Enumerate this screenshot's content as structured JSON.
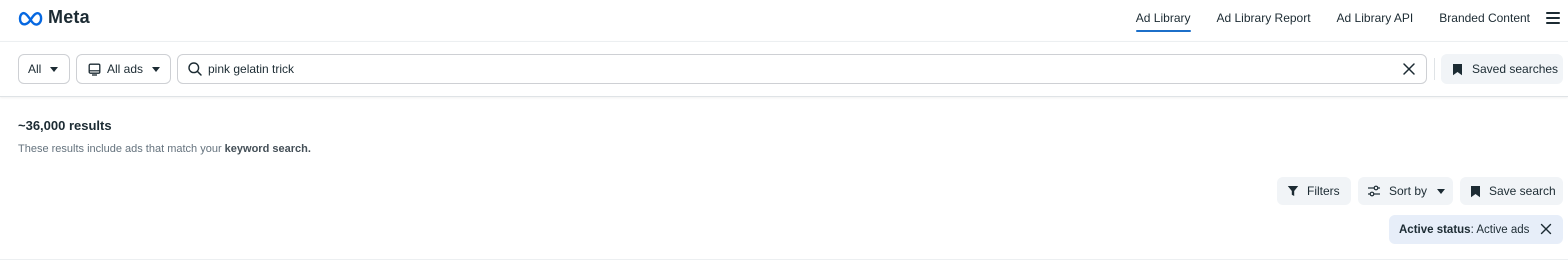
{
  "header": {
    "brand": "Meta",
    "nav": [
      {
        "label": "Ad Library",
        "active": true
      },
      {
        "label": "Ad Library Report",
        "active": false
      },
      {
        "label": "Ad Library API",
        "active": false
      },
      {
        "label": "Branded Content",
        "active": false
      }
    ],
    "accent_color": "#1c6fc9"
  },
  "search": {
    "country_select": "All",
    "ad_type_select": "All ads",
    "query": "pink gelatin trick",
    "saved_searches_label": "Saved searches"
  },
  "results": {
    "count_text": "~36,000 results",
    "description_prefix": "These results include ads that match your ",
    "description_bold": "keyword search."
  },
  "toolbar": {
    "filters_label": "Filters",
    "sort_label": "Sort by",
    "save_search_label": "Save search"
  },
  "active_filter": {
    "key": "Active status",
    "value": ": Active ads"
  },
  "icons": [
    "meta-logo-icon",
    "menu-icon",
    "caret-down-icon",
    "monitor-icon",
    "search-icon",
    "close-icon",
    "bookmark-icon",
    "filter-icon",
    "sliders-icon"
  ]
}
